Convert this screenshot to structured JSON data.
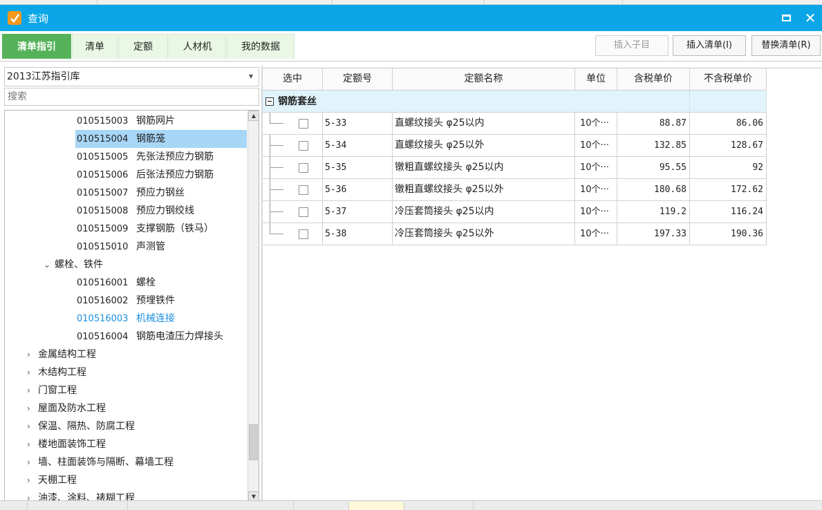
{
  "window": {
    "title": "查询"
  },
  "tabs": [
    {
      "label": "清单指引",
      "active": true
    },
    {
      "label": "清单"
    },
    {
      "label": "定额"
    },
    {
      "label": "人材机"
    },
    {
      "label": "我的数据"
    }
  ],
  "toolbar": {
    "insert_child": "插入子目",
    "insert_list": "插入清单(I)",
    "replace_list": "替换清单(R)"
  },
  "left": {
    "library": "2013江苏指引库",
    "search_placeholder": "搜索",
    "tree": [
      {
        "code": "010515003",
        "name": "钢筋网片"
      },
      {
        "code": "010515004",
        "name": "钢筋笼",
        "selected": true
      },
      {
        "code": "010515005",
        "name": "先张法预应力钢筋"
      },
      {
        "code": "010515006",
        "name": "后张法预应力钢筋"
      },
      {
        "code": "010515007",
        "name": "预应力钢丝"
      },
      {
        "code": "010515008",
        "name": "预应力钢绞线"
      },
      {
        "code": "010515009",
        "name": "支撑钢筋（铁马）"
      },
      {
        "code": "010515010",
        "name": "声测管"
      },
      {
        "group": "螺栓、铁件",
        "expanded": true
      },
      {
        "code": "010516001",
        "name": "螺栓"
      },
      {
        "code": "010516002",
        "name": "预埋铁件"
      },
      {
        "code": "010516003",
        "name": "机械连接",
        "highlight": true
      },
      {
        "code": "010516004",
        "name": "钢筋电渣压力焊接头"
      },
      {
        "chapter": "金属结构工程"
      },
      {
        "chapter": "木结构工程"
      },
      {
        "chapter": "门窗工程"
      },
      {
        "chapter": "屋面及防水工程"
      },
      {
        "chapter": "保温、隔热、防腐工程"
      },
      {
        "chapter": "楼地面装饰工程"
      },
      {
        "chapter": "墙、柱面装饰与隔断、幕墙工程"
      },
      {
        "chapter": "天棚工程"
      },
      {
        "chapter": "油漆、涂料、裱糊工程"
      }
    ]
  },
  "grid": {
    "headers": [
      "选中",
      "定额号",
      "定额名称",
      "单位",
      "含税单价",
      "不含税单价"
    ],
    "group": "钢筋套丝",
    "rows": [
      {
        "code": "5-33",
        "name": "直螺纹接头 φ25以内",
        "unit": "10个···",
        "tax_price": "88.87",
        "notax_price": "86.06"
      },
      {
        "code": "5-34",
        "name": "直螺纹接头 φ25以外",
        "unit": "10个···",
        "tax_price": "132.85",
        "notax_price": "128.67"
      },
      {
        "code": "5-35",
        "name": "镦粗直螺纹接头 φ25以内",
        "unit": "10个···",
        "tax_price": "95.55",
        "notax_price": "92"
      },
      {
        "code": "5-36",
        "name": "镦粗直螺纹接头 φ25以外",
        "unit": "10个···",
        "tax_price": "180.68",
        "notax_price": "172.62"
      },
      {
        "code": "5-37",
        "name": "冷压套筒接头 φ25以内",
        "unit": "10个···",
        "tax_price": "119.2",
        "notax_price": "116.24"
      },
      {
        "code": "5-38",
        "name": "冷压套筒接头 φ25以外",
        "unit": "10个···",
        "tax_price": "197.33",
        "notax_price": "190.36"
      }
    ]
  },
  "colors": {
    "title_bar": "#0aa6e8",
    "active_tab": "#55b25a",
    "selected_row": "#a8d6f7",
    "group_row": "#e1f3fb",
    "link": "#1a8ee0"
  }
}
